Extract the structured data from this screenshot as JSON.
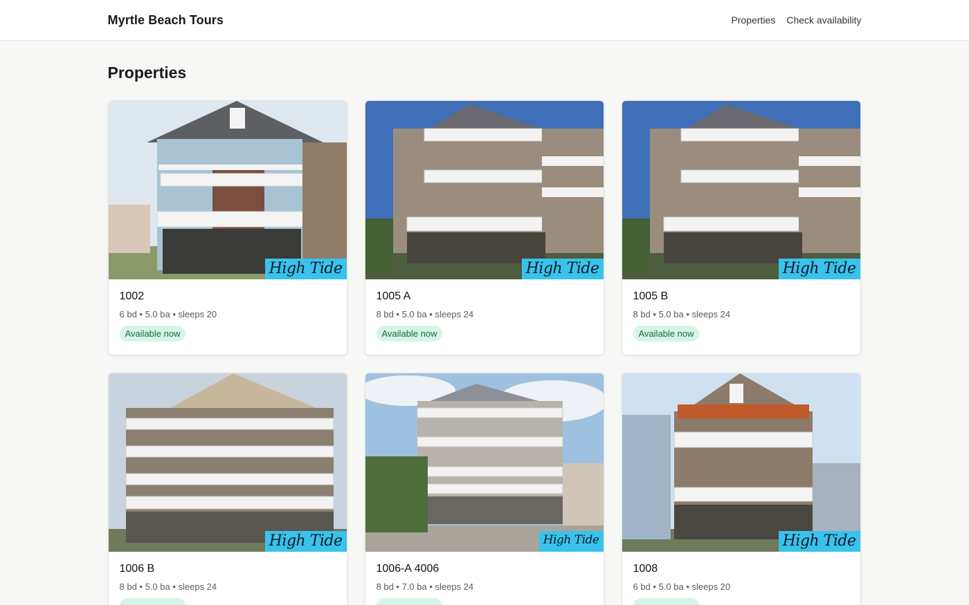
{
  "header": {
    "brand": "Myrtle Beach Tours",
    "nav": [
      {
        "label": "Properties"
      },
      {
        "label": "Check availability"
      }
    ]
  },
  "main": {
    "title": "Properties",
    "properties": [
      {
        "name": "1002",
        "meta": "6 bd • 5.0 ba • sleeps 20",
        "status": "Available now",
        "logo": "High Tide"
      },
      {
        "name": "1005 A",
        "meta": "8 bd • 5.0 ba • sleeps 24",
        "status": "Available now",
        "logo": "High Tide"
      },
      {
        "name": "1005 B",
        "meta": "8 bd • 5.0 ba • sleeps 24",
        "status": "Available now",
        "logo": "High Tide"
      },
      {
        "name": "1006 B",
        "meta": "8 bd • 5.0 ba • sleeps 24",
        "status": "",
        "logo": "High Tide"
      },
      {
        "name": "1006-A 4006",
        "meta": "8 bd • 7.0 ba • sleeps 24",
        "status": "",
        "logo": "High Tide"
      },
      {
        "name": "1008",
        "meta": "6 bd • 5.0 ba • sleeps 20",
        "status": "",
        "logo": "High Tide"
      }
    ]
  },
  "colors": {
    "badge_bg": "#d6f5e6",
    "badge_text": "#146b3a",
    "logo_bg": "#39c3ec"
  }
}
